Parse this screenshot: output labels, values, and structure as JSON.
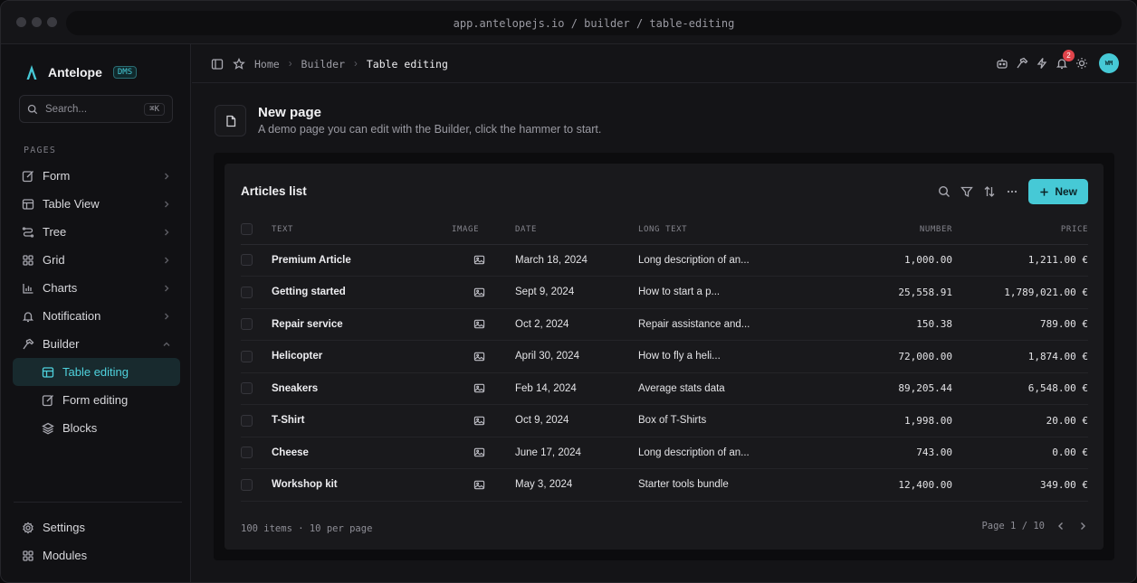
{
  "browser": {
    "url": "app.antelopejs.io / builder / table-editing"
  },
  "sidebar": {
    "brand": "Antelope",
    "badge": "DMS",
    "search_placeholder": "Search...",
    "search_shortcut": "⌘K",
    "section_label": "PAGES",
    "items": [
      {
        "label": "Form",
        "icon": "form-icon"
      },
      {
        "label": "Table View",
        "icon": "table-icon"
      },
      {
        "label": "Tree",
        "icon": "tree-icon"
      },
      {
        "label": "Grid",
        "icon": "grid-icon"
      },
      {
        "label": "Charts",
        "icon": "chart-icon"
      },
      {
        "label": "Notification",
        "icon": "bell-icon"
      },
      {
        "label": "Builder",
        "icon": "hammer-icon"
      }
    ],
    "sub_items": [
      {
        "label": "Table editing",
        "icon": "table-icon",
        "active": true
      },
      {
        "label": "Form editing",
        "icon": "form-icon"
      },
      {
        "label": "Blocks",
        "icon": "layers-icon"
      }
    ],
    "bottom_items": [
      {
        "label": "Settings",
        "icon": "gear-icon"
      },
      {
        "label": "Modules",
        "icon": "grid-icon"
      }
    ]
  },
  "topbar": {
    "breadcrumbs": [
      "Home",
      "Builder",
      "Table editing"
    ],
    "notification_count": "2",
    "avatar_initials": "WM"
  },
  "page": {
    "title": "New page",
    "subtitle": "A demo page you can edit with the Builder, click the hammer to start."
  },
  "table_card": {
    "title": "Articles list",
    "new_button": "New",
    "columns": [
      "TEXT",
      "IMAGE",
      "DATE",
      "LONG TEXT",
      "NUMBER",
      "PRICE"
    ],
    "rows": [
      {
        "text": "Premium Article",
        "date": "March 18, 2024",
        "long_text": "Long description of an...",
        "number": "1,000.00",
        "price": "1,211.00 €"
      },
      {
        "text": "Getting started",
        "date": "Sept 9, 2024",
        "long_text": "How to start a p...",
        "number": "25,558.91",
        "price": "1,789,021.00 €"
      },
      {
        "text": "Repair service",
        "date": "Oct 2, 2024",
        "long_text": "Repair assistance and...",
        "number": "150.38",
        "price": "789.00 €"
      },
      {
        "text": "Helicopter",
        "date": "April 30, 2024",
        "long_text": "How to fly a heli...",
        "number": "72,000.00",
        "price": "1,874.00 €"
      },
      {
        "text": "Sneakers",
        "date": "Feb 14, 2024",
        "long_text": "Average stats data",
        "number": "89,205.44",
        "price": "6,548.00 €"
      },
      {
        "text": "T-Shirt",
        "date": "Oct 9, 2024",
        "long_text": "Box of T-Shirts",
        "number": "1,998.00",
        "price": "20.00 €"
      },
      {
        "text": "Cheese",
        "date": "June 17, 2024",
        "long_text": "Long description of an...",
        "number": "743.00",
        "price": "0.00 €"
      },
      {
        "text": "Workshop kit",
        "date": "May 3, 2024",
        "long_text": "Starter tools bundle",
        "number": "12,400.00",
        "price": "349.00 €"
      }
    ],
    "footer_summary": "100 items · 10 per page",
    "pagination": "Page 1 / 10"
  },
  "colors": {
    "accent": "#46c9d6",
    "badge_red": "#e0444b",
    "background": "#141417"
  }
}
